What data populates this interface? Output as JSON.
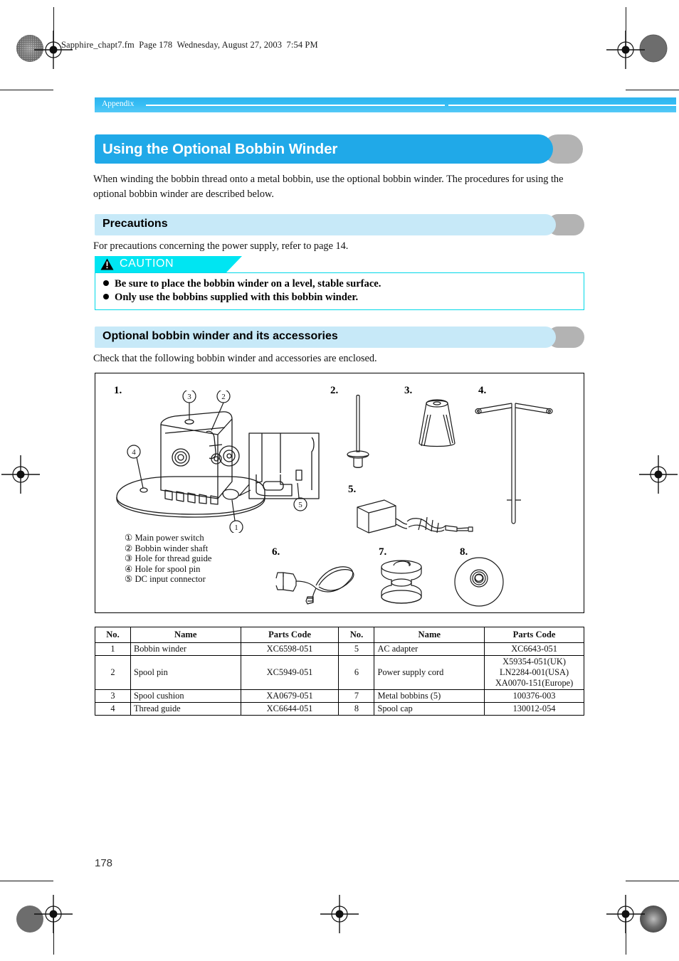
{
  "document": {
    "fm_header": "Sapphire_chapt7.fm  Page 178  Wednesday, August 27, 2003  7:54 PM",
    "page_number": "178",
    "running_head": "Appendix"
  },
  "title": {
    "text": "Using the Optional Bobbin Winder"
  },
  "intro": {
    "text": "When winding the bobbin thread onto a metal bobbin, use the optional bobbin winder. The procedures for using the optional bobbin winder are described below."
  },
  "precautions": {
    "heading": "Precautions",
    "note": "For precautions concerning the power supply, refer to page 14.",
    "caution_label": "CAUTION",
    "items": [
      "Be sure to place the bobbin winder on a level, stable surface.",
      "Only use the bobbins supplied with this bobbin winder."
    ]
  },
  "accessories": {
    "heading": "Optional bobbin winder and its accessories",
    "note": "Check that the following bobbin winder and accessories are enclosed.",
    "item_numbers": [
      "1.",
      "2.",
      "3.",
      "4.",
      "5.",
      "6.",
      "7.",
      "8."
    ],
    "callouts": [
      "1",
      "2",
      "3",
      "4",
      "5"
    ],
    "legend": [
      "① Main power switch",
      "② Bobbin winder shaft",
      "③ Hole for thread guide",
      "④ Hole for spool pin",
      "⑤ DC input connector"
    ]
  },
  "parts_table": {
    "headers": [
      "No.",
      "Name",
      "Parts Code",
      "No.",
      "Name",
      "Parts Code"
    ],
    "rows": [
      {
        "left_no": "1",
        "left_name": "Bobbin winder",
        "left_code": "XC6598-051",
        "right_no": "5",
        "right_name": "AC adapter",
        "right_code": "XC6643-051"
      },
      {
        "left_no": "2",
        "left_name": "Spool pin",
        "left_code": "XC5949-051",
        "right_no": "6",
        "right_name": "Power supply cord",
        "right_code": "X59354-051(UK)\nLN2284-001(USA)\nXA0070-151(Europe)"
      },
      {
        "left_no": "3",
        "left_name": "Spool cushion",
        "left_code": "XA0679-051",
        "right_no": "7",
        "right_name": "Metal bobbins (5)",
        "right_code": "100376-003"
      },
      {
        "left_no": "4",
        "left_name": "Thread guide",
        "left_code": "XC6644-051",
        "right_no": "8",
        "right_name": "Spool cap",
        "right_code": "130012-054"
      }
    ]
  },
  "colors": {
    "title_blue": "#20a9e8",
    "section_blue": "#c7e9f8",
    "caution_cyan": "#00e5f2",
    "shadow_gray": "#b3b3b3"
  }
}
